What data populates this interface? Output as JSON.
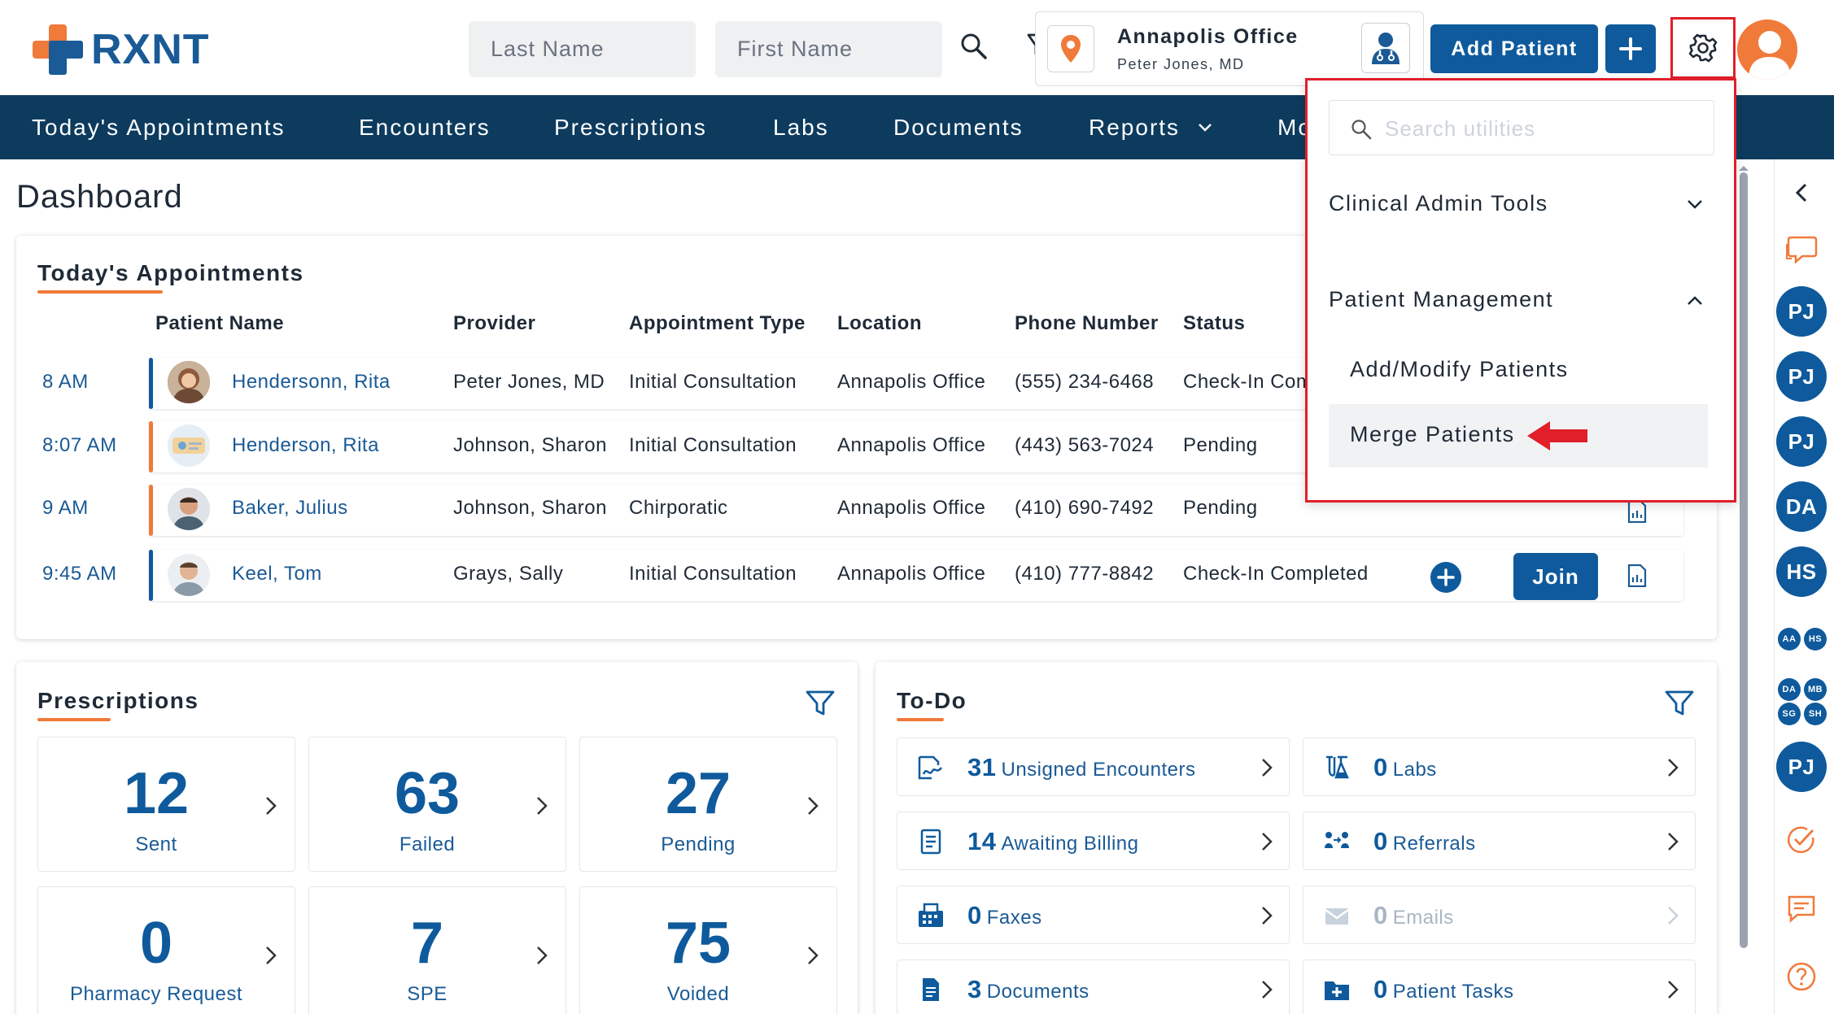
{
  "brand": {
    "logo_text": "RXNT"
  },
  "search": {
    "last_name_placeholder": "Last Name",
    "first_name_placeholder": "First Name"
  },
  "office": {
    "name": "Annapolis Office",
    "doctor": "Peter Jones, MD"
  },
  "header": {
    "add_patient_label": "Add Patient",
    "plus_label": "+"
  },
  "nav": {
    "items": [
      "Today's Appointments",
      "Encounters",
      "Prescriptions",
      "Labs",
      "Documents",
      "Reports",
      "Mo"
    ]
  },
  "page": {
    "title": "Dashboard"
  },
  "appointments": {
    "title": "Today's Appointments",
    "columns": [
      "Patient Name",
      "Provider",
      "Appointment Type",
      "Location",
      "Phone Number",
      "Status"
    ],
    "rows": [
      {
        "time": "8 AM",
        "name": "Hendersonn, Rita",
        "provider": "Peter Jones, MD",
        "type": "Initial Consultation",
        "location": "Annapolis Office",
        "phone": "(555) 234-6468",
        "status": "Check-In Com",
        "bar_color": "#0e5a9c"
      },
      {
        "time": "8:07 AM",
        "name": "Henderson, Rita",
        "provider": "Johnson, Sharon",
        "type": "Initial Consultation",
        "location": "Annapolis Office",
        "phone": "(443) 563-7024",
        "status": "Pending",
        "bar_color": "#f07a3a"
      },
      {
        "time": "9 AM",
        "name": "Baker, Julius",
        "provider": "Johnson, Sharon",
        "type": "Chirporatic",
        "location": "Annapolis Office",
        "phone": "(410) 690-7492",
        "status": "Pending",
        "bar_color": "#f07a3a"
      },
      {
        "time": "9:45 AM",
        "name": "Keel, Tom",
        "provider": "Grays, Sally",
        "type": "Initial Consultation",
        "location": "Annapolis Office",
        "phone": "(410) 777-8842",
        "status": "Check-In Completed",
        "bar_color": "#0e5a9c"
      }
    ],
    "join_label": "Join"
  },
  "prescriptions": {
    "title": "Prescriptions",
    "tiles": [
      {
        "value": "12",
        "label": "Sent"
      },
      {
        "value": "63",
        "label": "Failed"
      },
      {
        "value": "27",
        "label": "Pending"
      },
      {
        "value": "0",
        "label": "Pharmacy Request"
      },
      {
        "value": "7",
        "label": "SPE"
      },
      {
        "value": "75",
        "label": "Voided"
      }
    ]
  },
  "todo": {
    "title": "To-Do",
    "items": [
      {
        "count": "31",
        "label": "Unsigned Encounters",
        "icon": "signature-icon"
      },
      {
        "count": "0",
        "label": "Labs",
        "icon": "flask-icon"
      },
      {
        "count": "14",
        "label": "Awaiting Billing",
        "icon": "billing-icon"
      },
      {
        "count": "0",
        "label": "Referrals",
        "icon": "referral-icon"
      },
      {
        "count": "0",
        "label": "Faxes",
        "icon": "fax-icon"
      },
      {
        "count": "0",
        "label": "Emails",
        "icon": "email-icon"
      },
      {
        "count": "3",
        "label": "Documents",
        "icon": "document-icon"
      },
      {
        "count": "0",
        "label": "Patient Tasks",
        "icon": "task-icon"
      }
    ]
  },
  "utilities": {
    "search_placeholder": "Search utilities",
    "sections": [
      {
        "label": "Clinical Admin Tools",
        "expanded": false
      },
      {
        "label": "Patient Management",
        "expanded": true
      }
    ],
    "items": [
      "Add/Modify Patients",
      "Merge Patients"
    ]
  },
  "rail": {
    "avatars_large": [
      "PJ",
      "PJ",
      "PJ",
      "DA",
      "HS"
    ],
    "avatars_small_row1": [
      "AA",
      "HS"
    ],
    "avatars_small_grid": [
      "DA",
      "MB",
      "SG",
      "SH"
    ],
    "avatar_last": "PJ"
  },
  "colors": {
    "primary": "#0e5a9c",
    "nav": "#0d3b5e",
    "accent": "#f07a3a",
    "highlight": "#e01f2a"
  }
}
